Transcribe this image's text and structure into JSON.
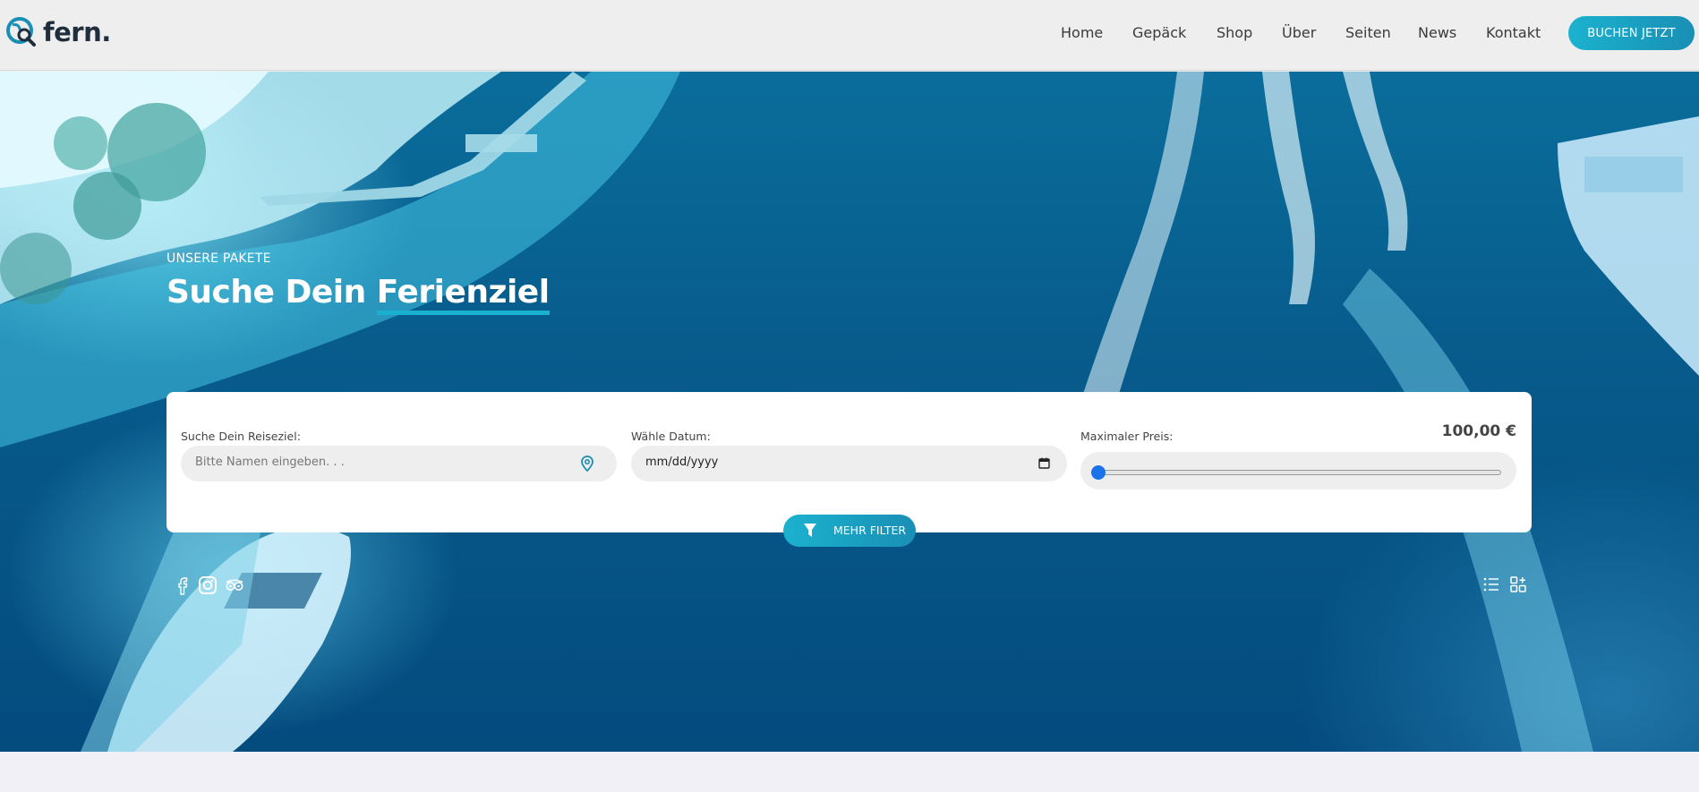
{
  "brand": {
    "name": "fern."
  },
  "nav": {
    "items": [
      {
        "label": "Home"
      },
      {
        "label": "Gepäck"
      },
      {
        "label": "Shop"
      },
      {
        "label": "Über"
      },
      {
        "label": "Seiten"
      },
      {
        "label": "News"
      },
      {
        "label": "Kontakt"
      }
    ],
    "cta_label": "BUCHEN JETZT"
  },
  "hero": {
    "kicker": "UNSERE PAKETE",
    "title_prefix": "Suche Dein",
    "title_highlight": "Ferienziel"
  },
  "search": {
    "destination_label": "Suche Dein Reiseziel:",
    "destination_placeholder": "Bitte Namen eingeben. . .",
    "destination_value": "",
    "date_label": "Wähle Datum:",
    "date_value": "mm/dd/yyyy",
    "price_label": "Maximaler Preis:",
    "price_value": "100,00 €",
    "price_slider_fraction": 0.0,
    "more_filters_label": "MEHR FILTER"
  },
  "social": [
    "facebook-icon",
    "instagram-icon",
    "tripadvisor-icon"
  ],
  "view_toggle": [
    "list-view-icon",
    "grid-view-icon"
  ],
  "colors": {
    "accent": "#1ab0cf",
    "accent_dark": "#1a8fb5",
    "header_bg": "#eeeeee",
    "slider_thumb": "#1a73e8"
  }
}
